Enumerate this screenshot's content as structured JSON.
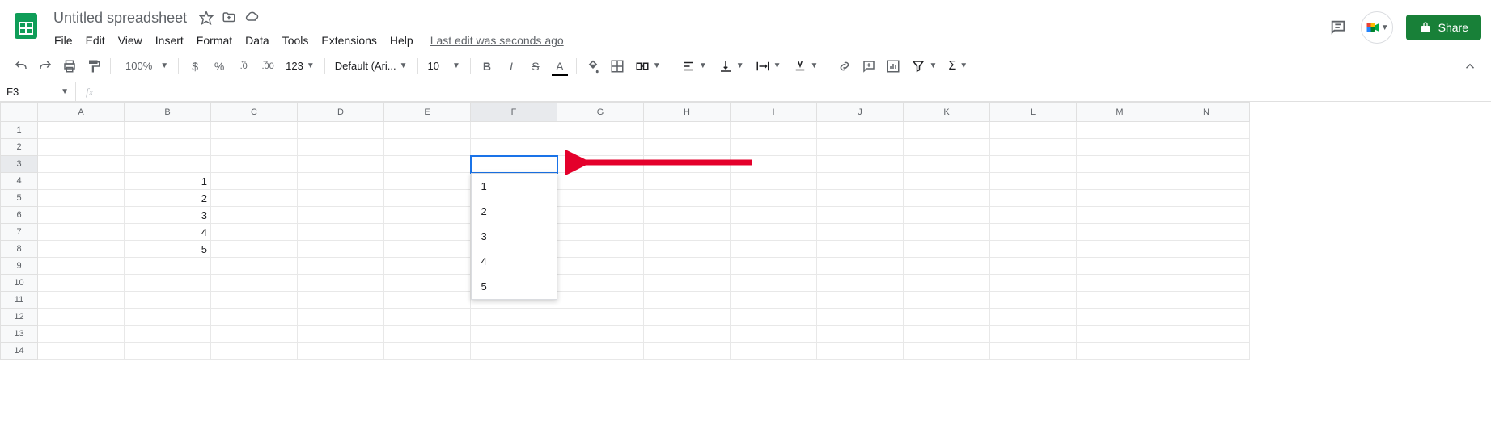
{
  "doc": {
    "title": "Untitled spreadsheet"
  },
  "menubar": {
    "file": "File",
    "edit": "Edit",
    "view": "View",
    "insert": "Insert",
    "format": "Format",
    "data": "Data",
    "tools": "Tools",
    "extensions": "Extensions",
    "help": "Help",
    "last_edit": "Last edit was seconds ago"
  },
  "share": {
    "label": "Share"
  },
  "toolbar": {
    "zoom": "100%",
    "currency": "$",
    "percent": "%",
    "dec_dec": ".0",
    "inc_dec": ".00",
    "more_fmt": "123",
    "font": "Default (Ari...",
    "font_size": "10"
  },
  "namebox": {
    "value": "F3"
  },
  "formula": {
    "placeholder": "fx",
    "value": ""
  },
  "columns": [
    "A",
    "B",
    "C",
    "D",
    "E",
    "F",
    "G",
    "H",
    "I",
    "J",
    "K",
    "L",
    "M",
    "N"
  ],
  "rows": [
    "1",
    "2",
    "3",
    "4",
    "5",
    "6",
    "7",
    "8",
    "9",
    "10",
    "11",
    "12",
    "13",
    "14"
  ],
  "active_cell": {
    "col": "F",
    "row": "3"
  },
  "cell_data": {
    "B4": "1",
    "B5": "2",
    "B6": "3",
    "B7": "4",
    "B8": "5"
  },
  "dropdown": {
    "items": [
      "1",
      "2",
      "3",
      "4",
      "5"
    ]
  }
}
